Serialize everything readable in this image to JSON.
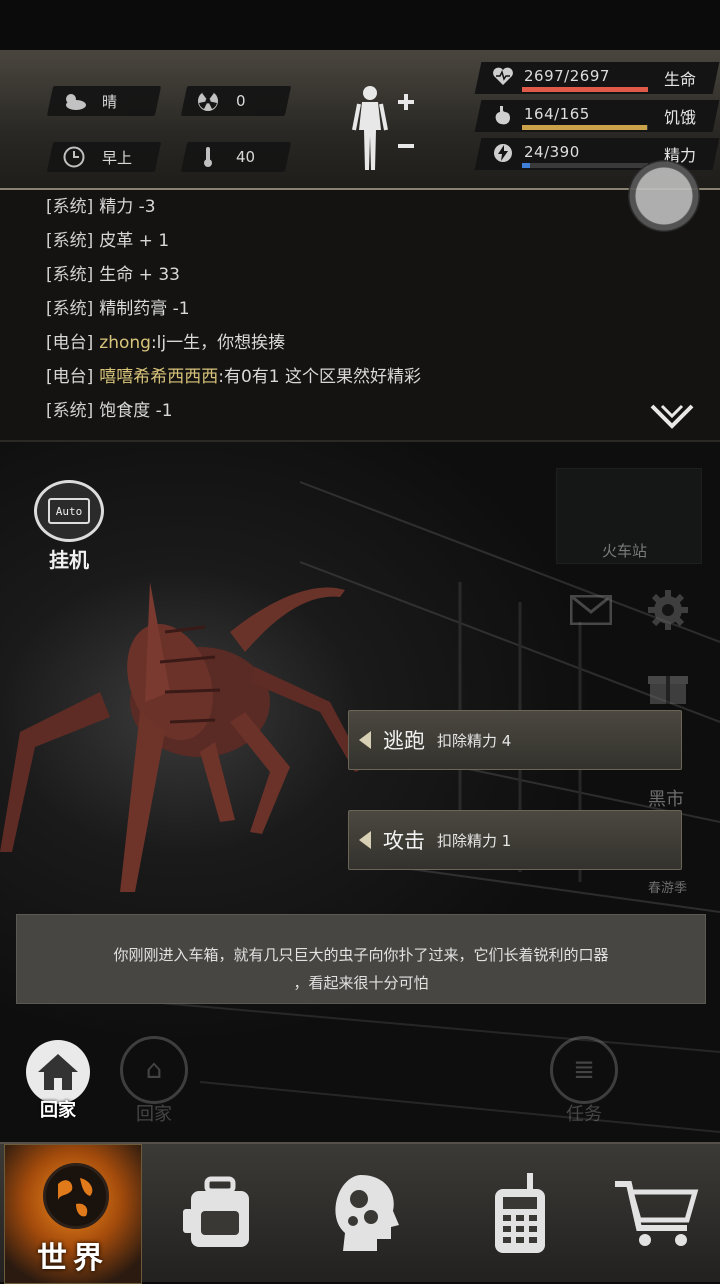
{
  "status": {
    "weather": "晴",
    "radiation": "0",
    "time_of_day": "早上",
    "temperature": "40"
  },
  "vitals": [
    {
      "label": "生命",
      "value": "2697/2697",
      "fraction": 1.0,
      "color": "#e05a4a",
      "icon": "heart-icon"
    },
    {
      "label": "饥饿",
      "value": "164/165",
      "fraction": 0.994,
      "color": "#c9a24a",
      "icon": "stomach-icon"
    },
    {
      "label": "精力",
      "value": "24/390",
      "fraction": 0.062,
      "color": "#3f7fd9",
      "icon": "energy-icon"
    }
  ],
  "log": [
    {
      "tag": "[系统]",
      "text": "精力 -3"
    },
    {
      "tag": "[系统]",
      "text": "皮革 + 1"
    },
    {
      "tag": "[系统]",
      "text": "生命 + 33"
    },
    {
      "tag": "[系统]",
      "text": "精制药膏 -1"
    },
    {
      "tag": "[电台]",
      "who": "zhong",
      "text": ":lj一生，你想挨揍"
    },
    {
      "tag": "[电台]",
      "who": "嘻嘻希希西西西",
      "text": ":有0有1 这个区果然好精彩"
    },
    {
      "tag": "[系统]",
      "text": "饱食度 -1"
    }
  ],
  "auto": {
    "screen": "Auto",
    "label": "挂机"
  },
  "scene": {
    "station": "火车站",
    "black_market": "黑市",
    "spring_tour": "春游季"
  },
  "actions": [
    {
      "name": "逃跑",
      "cost": "扣除精力 4"
    },
    {
      "name": "攻击",
      "cost": "扣除精力 1"
    }
  ],
  "description": {
    "line1": "你刚刚进入车箱，就有几只巨大的虫子向你扑了过来，它们长着锐利的口器",
    "line2": "，看起来很十分可怕"
  },
  "home": {
    "label": "回家"
  },
  "ghost": {
    "home": "回家",
    "task": "任务"
  },
  "nav": {
    "world": "世界"
  }
}
